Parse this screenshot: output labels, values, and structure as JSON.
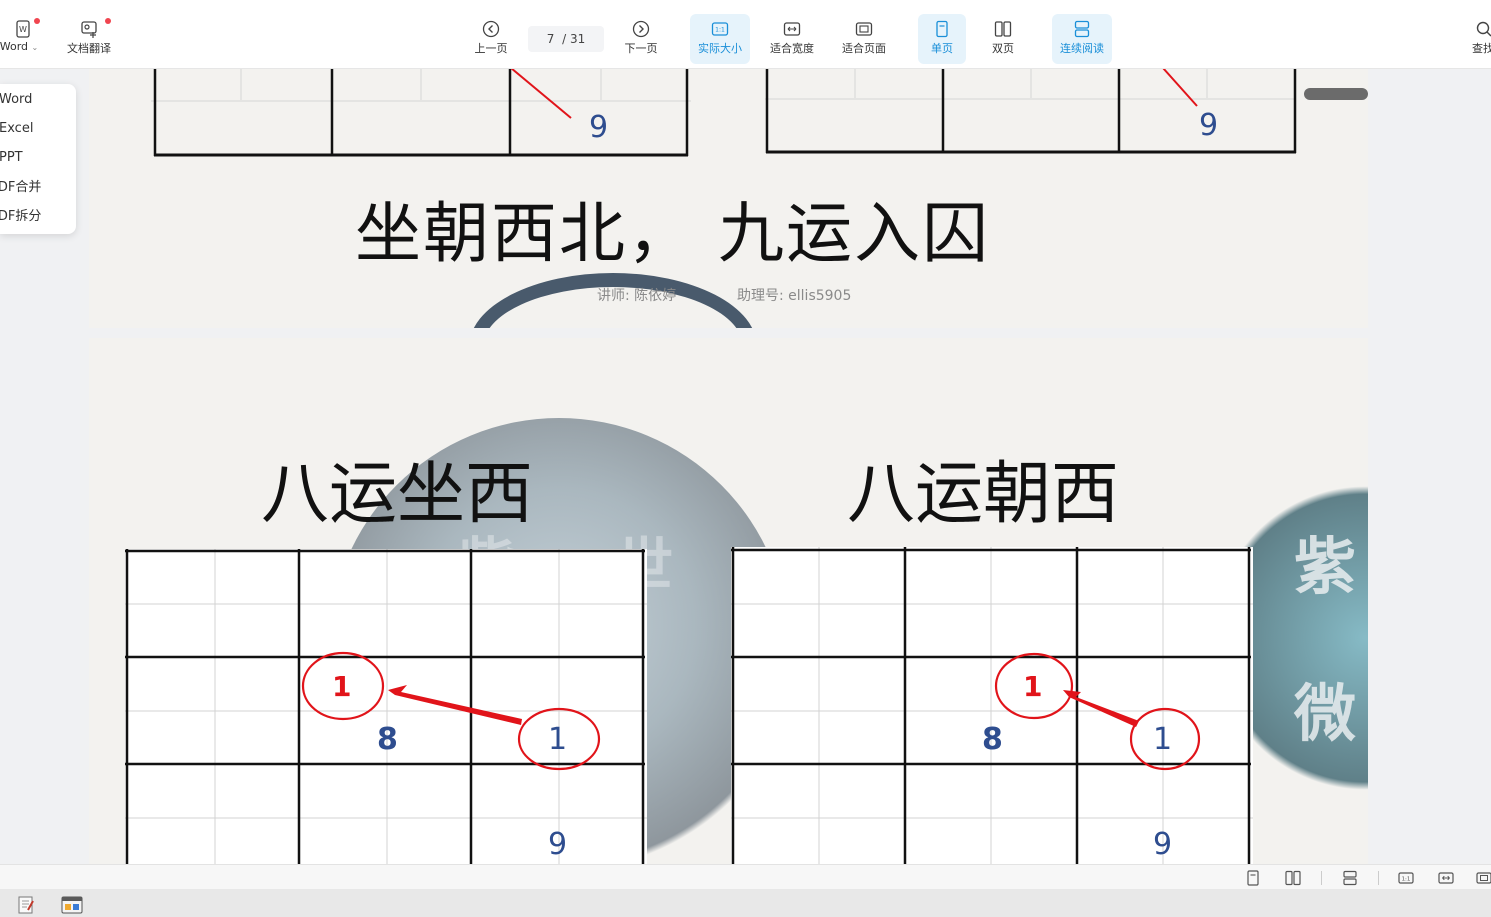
{
  "toolbar": {
    "word_label": "Word",
    "translate_label": "文档翻译",
    "prev_label": "上一页",
    "next_label": "下一页",
    "page_current": "7",
    "page_total": "/ 31",
    "actual_size_label": "实际大小",
    "fit_width_label": "适合宽度",
    "fit_page_label": "适合页面",
    "single_page_label": "单页",
    "double_page_label": "双页",
    "continuous_label": "连续阅读",
    "search_label": "查找",
    "actual_size_glyph": "1:1"
  },
  "dropdown": {
    "items": [
      "转Word",
      "转Excel",
      "转PPT",
      "PDF合并",
      "PDF拆分"
    ]
  },
  "slide1": {
    "title": "坐朝西北， 九运入囚",
    "lecturer": "讲师: 陈依婷",
    "assistant": "助理号: ellis5905",
    "left_num": "9",
    "right_num": "9"
  },
  "slide2": {
    "left_title": "八运坐西",
    "right_title": "八运朝西",
    "left_grid": {
      "red_num": "1",
      "center_num": "8",
      "right_num": "1",
      "bottom_num": "9"
    },
    "right_grid": {
      "red_num": "1",
      "center_num": "8",
      "right_num": "1",
      "bottom_num": "9"
    },
    "watermark_char1": "紫",
    "watermark_char2": "微",
    "watermark_partial": "紫 世"
  },
  "colors": {
    "accent": "#1a8fd8",
    "active_bg": "#e6f3fb",
    "red_mark": "#e1141a",
    "blue_num": "#2e4d8f",
    "notification_dot": "#f0454f"
  }
}
